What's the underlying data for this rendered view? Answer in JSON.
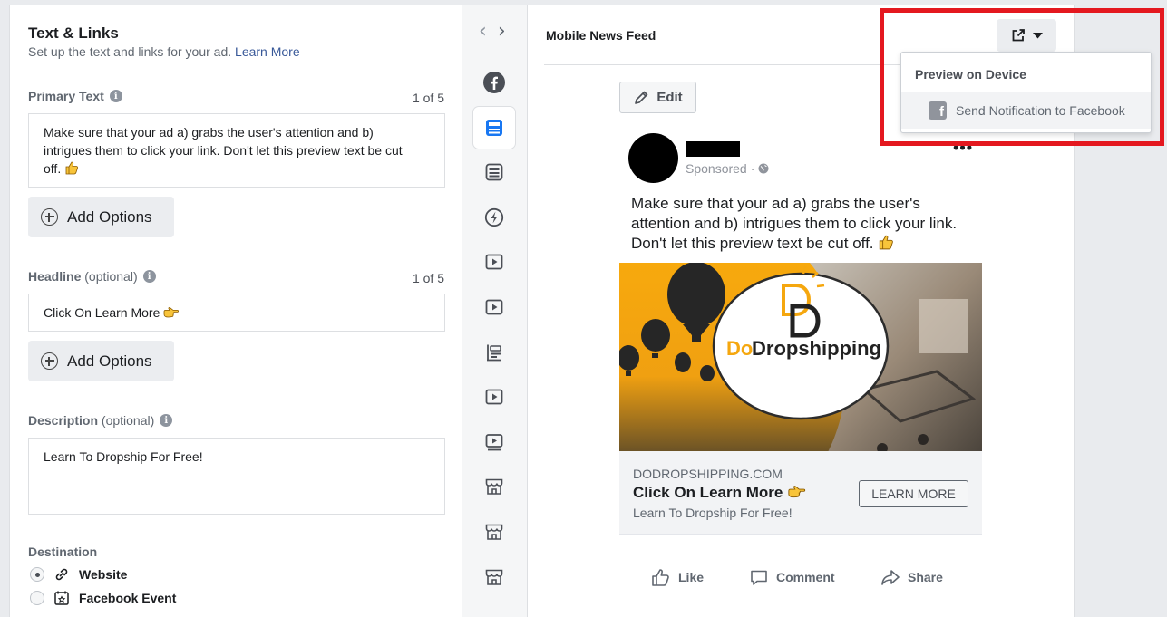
{
  "left": {
    "title": "Text & Links",
    "subtitle": "Set up the text and links for your ad.",
    "learn_more": "Learn More",
    "primary_text": {
      "label": "Primary Text",
      "counter": "1 of 5",
      "value": "Make sure that your ad a) grabs the user's attention and b) intrigues them to click your link. Don't let this preview text be cut off."
    },
    "add_options": "Add Options",
    "headline": {
      "label": "Headline",
      "optional": "(optional)",
      "counter": "1 of 5",
      "value": "Click On Learn More"
    },
    "description": {
      "label": "Description",
      "optional": "(optional)",
      "value": "Learn To Dropship For Free!"
    },
    "destination": {
      "label": "Destination",
      "options": [
        "Website",
        "Facebook Event"
      ],
      "selected": "Website"
    }
  },
  "strip": {
    "icons": [
      "facebook-icon",
      "feed-icon",
      "marketplace-icon",
      "instant-articles-icon",
      "video-feed-icon",
      "in-stream-video-icon",
      "search-results-icon",
      "story-video-icon",
      "video-icon",
      "shop-icon",
      "shop-icon",
      "shop-icon"
    ]
  },
  "preview": {
    "title": "Mobile News Feed",
    "edit_label": "Edit",
    "sponsored": "Sponsored",
    "post_text": "Make sure that your ad a) grabs the user's attention and b) intrigues them to click your link. Don't let this preview text be cut off.",
    "brand_logo_text": "DoDropshipping",
    "domain": "DODROPSHIPPING.COM",
    "headline": "Click On Learn More",
    "description": "Learn To Dropship For Free!",
    "cta": "LEARN MORE",
    "reactions": [
      "Like",
      "Comment",
      "Share"
    ]
  },
  "dropdown": {
    "header": "Preview on Device",
    "item": "Send Notification to Facebook"
  },
  "colors": {
    "accent_link": "#385898",
    "highlight": "#e4181f",
    "banner_orange": "#f5a70f"
  }
}
